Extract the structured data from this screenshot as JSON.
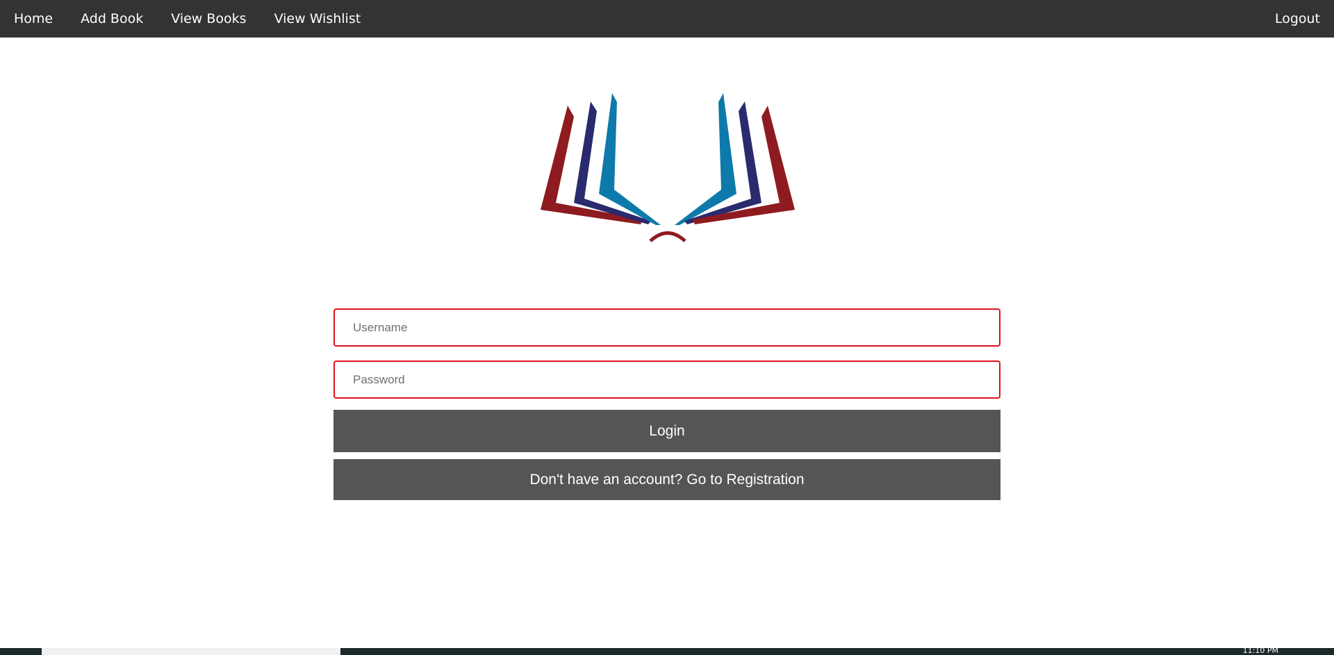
{
  "nav": {
    "items": [
      {
        "label": "Home"
      },
      {
        "label": "Add Book"
      },
      {
        "label": "View Books"
      },
      {
        "label": "View Wishlist"
      }
    ],
    "logout_label": "Logout"
  },
  "logo": {
    "icon": "open-book-logo",
    "colors": {
      "outer": "#8e1b1f",
      "middle": "#2a2a6e",
      "inner": "#0e7aab"
    }
  },
  "form": {
    "username_placeholder": "Username",
    "password_placeholder": "Password",
    "login_label": "Login",
    "register_label": "Don't have an account? Go to Registration"
  },
  "colors": {
    "navbar": "#333333",
    "button": "#555555",
    "input_border": "#e0111b"
  },
  "taskbar": {
    "clock": "11:10 PM"
  }
}
